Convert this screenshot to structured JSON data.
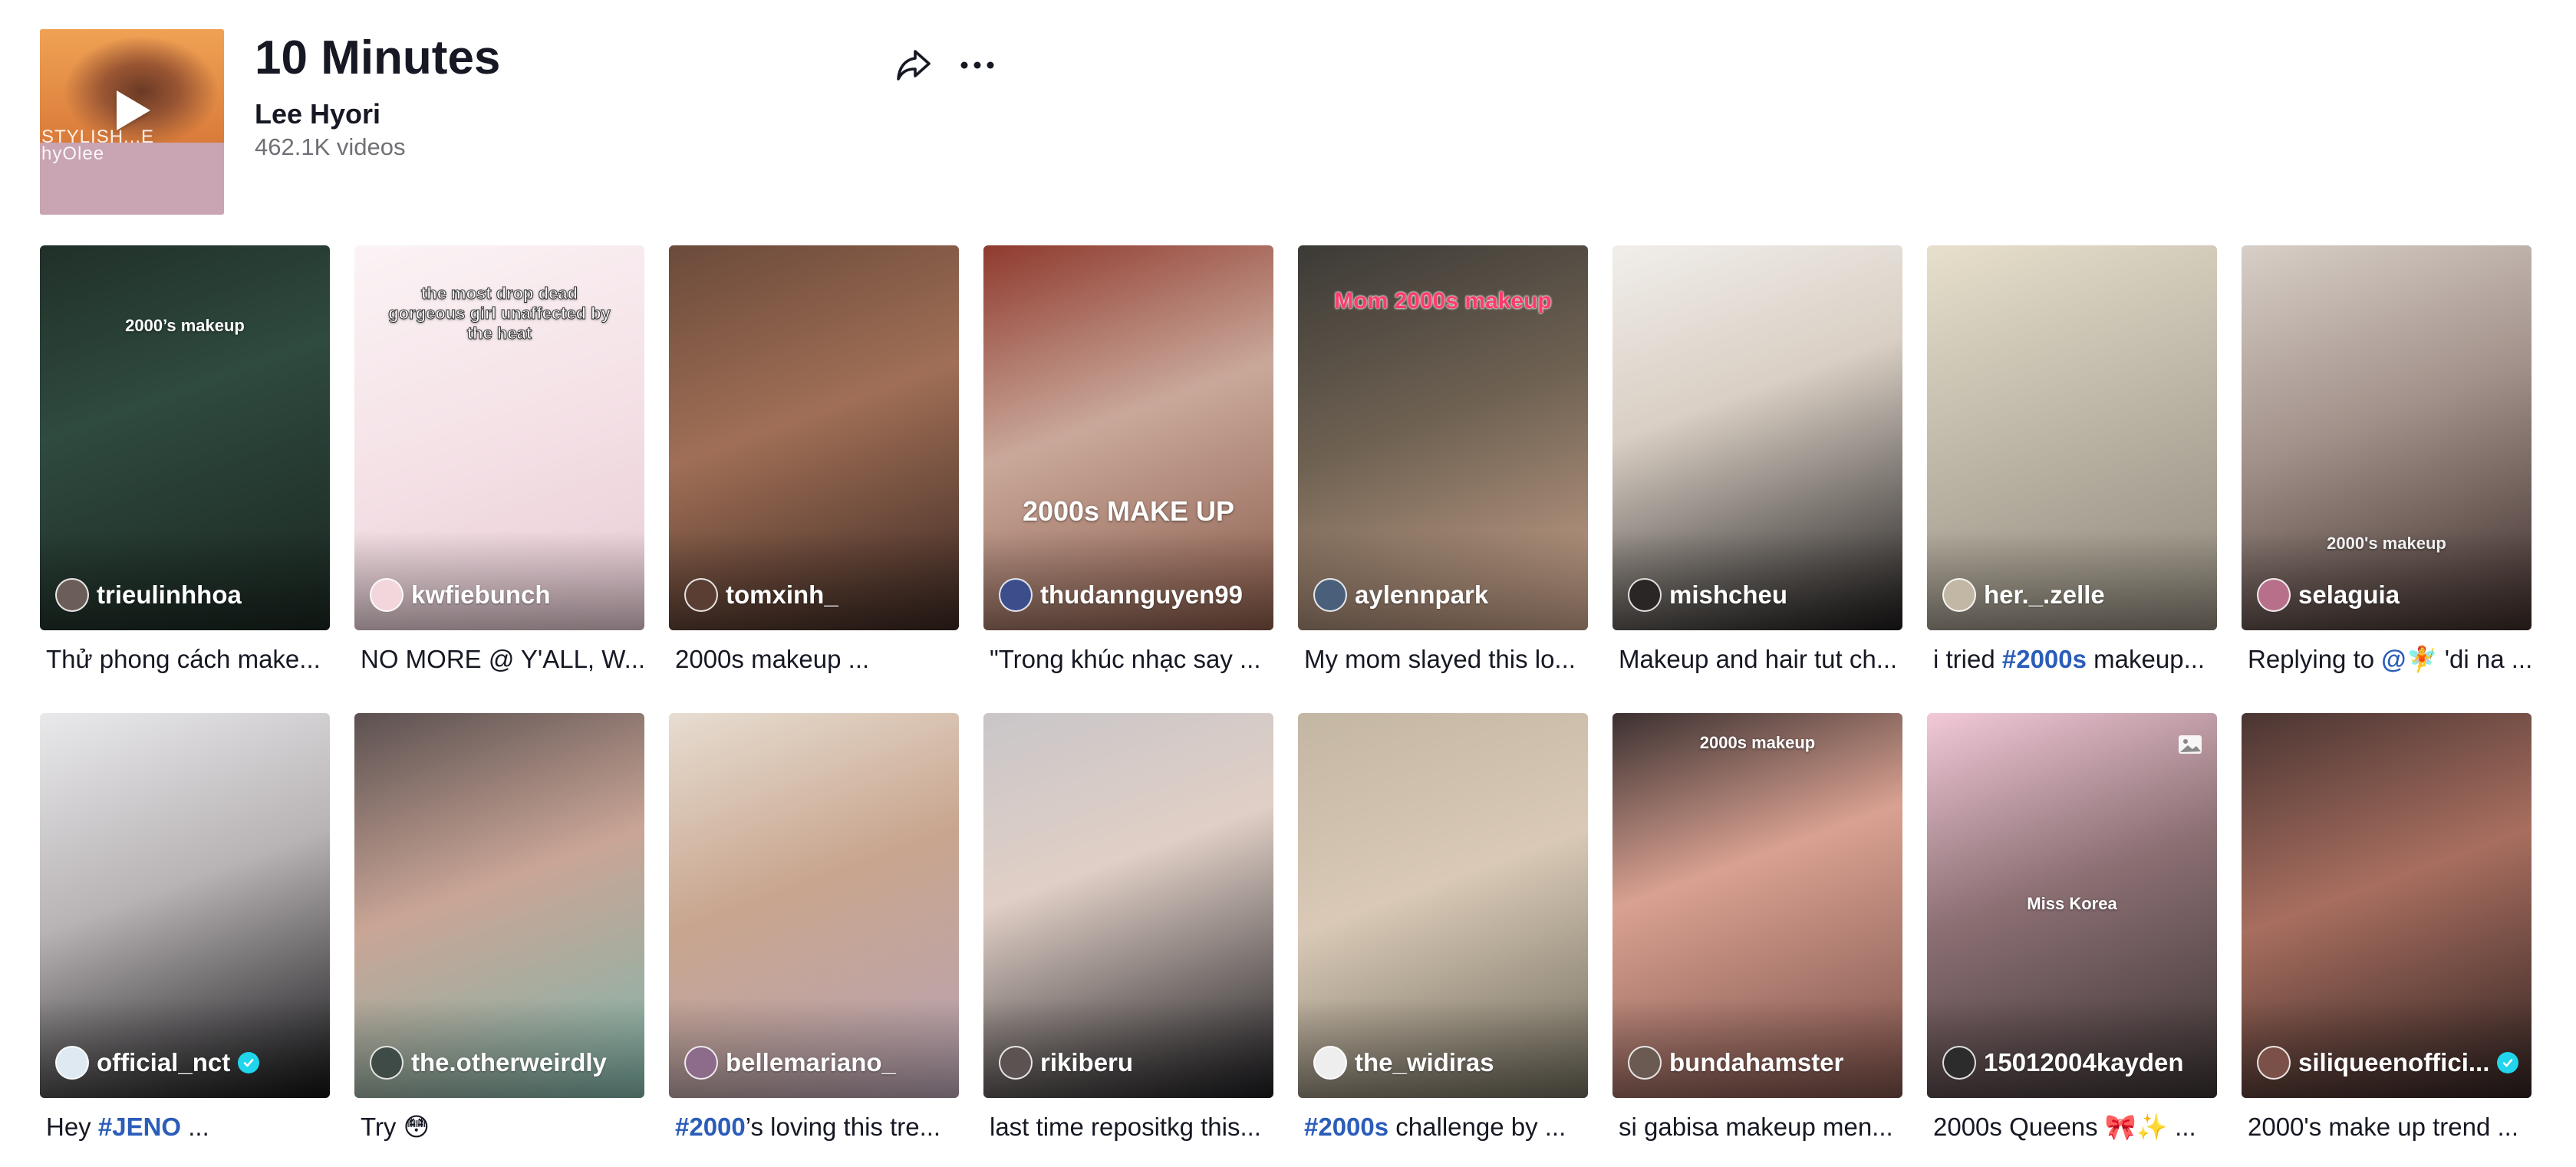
{
  "header": {
    "title": "10 Minutes",
    "artist": "Lee Hyori",
    "video_count": "462.1K videos",
    "cover_text_line1": "STYLISH...E",
    "cover_text_line2": "hyOlee"
  },
  "videos": [
    {
      "creator": "trieulinhhoa",
      "verified": false,
      "overlay": "2000’s makeup",
      "caption": {
        "pre": "",
        "tag": "",
        "post": "Thử phong cách make..."
      },
      "bg": "linear-gradient(160deg,#203028 0%,#2f4a3f 40%,#1a2620 100%)",
      "avatar": "#6b5d58"
    },
    {
      "creator": "kwfiebunch",
      "verified": false,
      "overlay": "the most drop dead gorgeous girl unaffected by the heat",
      "caption": {
        "pre": "",
        "tag": "",
        "post": "NO MORE @ Y'ALL, W..."
      },
      "bg": "linear-gradient(160deg,#fbf3f5 0%,#f4e1e6 50%,#e8ccd4 100%)",
      "avatar": "#f3d6dc"
    },
    {
      "creator": "tomxinh_",
      "verified": false,
      "overlay": "",
      "caption": {
        "pre": "",
        "tag": "",
        "post": "2000s makeup ..."
      },
      "bg": "linear-gradient(160deg,#6b4a3a 0%,#a06f56 45%,#3a2721 100%)",
      "avatar": "#5a3e34"
    },
    {
      "creator": "thudannguyen99",
      "verified": false,
      "overlay": "2000s MAKE UP",
      "caption": {
        "pre": "\"Trong khúc nhạc say ...",
        "tag": "",
        "post": ""
      },
      "bg": "linear-gradient(160deg,#8f3a2e 0%,#c9a89a 45%,#8a5b4a 100%)",
      "avatar": "#3b4d8a"
    },
    {
      "creator": "aylennpark",
      "verified": false,
      "overlay": "Mom 2000s makeup",
      "caption": {
        "pre": "My mom slayed this lo...",
        "tag": "",
        "post": ""
      },
      "bg": "linear-gradient(160deg,#3c3a36 0%,#6e6152 45%,#c9a38b 100%)",
      "avatar": "#4a5f7a"
    },
    {
      "creator": "mishcheu",
      "verified": false,
      "overlay": "",
      "caption": {
        "pre": "Makeup and hair tut ch...",
        "tag": "",
        "post": ""
      },
      "bg": "linear-gradient(160deg,#f1eeea 0%,#d9cfc4 40%,#1d1b1b 100%)",
      "avatar": "#2a2626"
    },
    {
      "creator": "her._.zelle",
      "verified": false,
      "overlay": "",
      "caption": {
        "pre": "i tried ",
        "tag": "#2000s",
        "post": " makeup..."
      },
      "bg": "linear-gradient(160deg,#e7e0cc 0%,#bfb7a8 45%,#8e877a 100%)",
      "avatar": "#c2b7a5"
    },
    {
      "creator": "selaguia",
      "verified": false,
      "overlay": "2000's makeup",
      "caption": {
        "pre": "Replying to ",
        "tag": "@🧚",
        "post": " 'di na ..."
      },
      "bg": "linear-gradient(160deg,#d8cfc8 0%,#a2918a 45%,#3b2b28 100%)",
      "avatar": "#b8708a"
    },
    {
      "creator": "official_nct",
      "verified": true,
      "overlay": "",
      "caption": {
        "pre": "Hey ",
        "tag": "#JENO",
        "post": " ..."
      },
      "bg": "linear-gradient(160deg,#e9e9ec 0%,#b8b3b5 45%,#121214 100%)",
      "avatar": "#dfe9f2"
    },
    {
      "creator": "the.otherweirdly",
      "verified": false,
      "overlay": "",
      "caption": {
        "pre": "Try 😳",
        "tag": "",
        "post": ""
      },
      "bg": "linear-gradient(160deg,#5b5050 0%,#c9a596 45%,#7fb6aa 100%)",
      "avatar": "#3f4b46"
    },
    {
      "creator": "bellemariano_",
      "verified": false,
      "overlay": "",
      "caption": {
        "pre": "",
        "tag": "#2000",
        "post": "’s loving this tre..."
      },
      "bg": "linear-gradient(160deg,#e7ddd1 0%,#c8a58e 45%,#b9a4b4 100%)",
      "avatar": "#8d6b8a"
    },
    {
      "creator": "rikiberu",
      "verified": false,
      "overlay": "",
      "caption": {
        "pre": "last time repositkg this...",
        "tag": "",
        "post": ""
      },
      "bg": "linear-gradient(160deg,#c9c6c8 0%,#e0cfc6 40%,#1b1b1f 100%)",
      "avatar": "#5c5252"
    },
    {
      "creator": "the_widiras",
      "verified": false,
      "overlay": "",
      "caption": {
        "pre": "",
        "tag": "#2000s",
        "post": " challenge by ..."
      },
      "bg": "linear-gradient(160deg,#c3b6a2 0%,#d9c9b6 45%,#6e6a5b 100%)",
      "avatar": "#eeeeee"
    },
    {
      "creator": "bundahamster",
      "verified": false,
      "overlay": "2000s makeup",
      "caption": {
        "pre": "si gabisa makeup men...",
        "tag": "",
        "post": ""
      },
      "bg": "linear-gradient(160deg,#3b3030 0%,#d9a191 40%,#7a4f48 100%)",
      "avatar": "#6b5a52"
    },
    {
      "creator": "15012004kayden",
      "verified": false,
      "overlay": "Miss Korea",
      "caption": {
        "pre": "2000s Queens 🎀✨ ...",
        "tag": "",
        "post": ""
      },
      "bg": "linear-gradient(160deg,#f2c9d8 0%,#8b6f73 45%,#3a3232 100%)",
      "avatar": "#2c2c2c"
    },
    {
      "creator": "siliqueenoffici...",
      "verified": true,
      "overlay": "",
      "caption": {
        "pre": "2000's make up trend ...",
        "tag": "",
        "post": ""
      },
      "bg": "linear-gradient(160deg,#4a3532 0%,#a86e5f 45%,#2d2120 100%)",
      "avatar": "#7a5048"
    }
  ],
  "colors": {
    "accent_link": "#2b5db9",
    "verified": "#20d5ec",
    "secondary_text": "#6f6f75"
  },
  "icons": {
    "share": "share-arrow-icon",
    "more": "ellipsis-icon",
    "play": "play-icon",
    "verified": "verified-check-icon",
    "gallery": "photo-gallery-icon"
  }
}
